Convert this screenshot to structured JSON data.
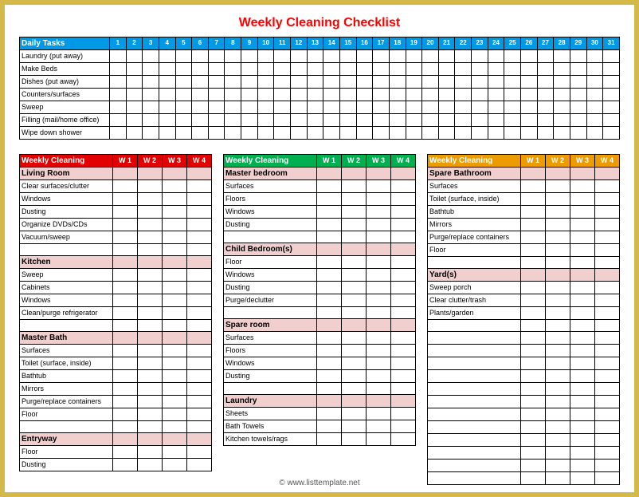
{
  "title": "Weekly Cleaning Checklist",
  "daily_header": "Daily Tasks",
  "daily_days": [
    "1",
    "2",
    "3",
    "4",
    "5",
    "6",
    "7",
    "8",
    "9",
    "10",
    "11",
    "12",
    "13",
    "14",
    "15",
    "16",
    "17",
    "18",
    "19",
    "20",
    "21",
    "22",
    "23",
    "24",
    "25",
    "26",
    "27",
    "28",
    "29",
    "30",
    "31"
  ],
  "daily_tasks": [
    "Laundry (put away)",
    "Make Beds",
    "Dishes (put away)",
    "Counters/surfaces",
    "Sweep",
    "Filling (mail/home office)",
    "Wipe down shower"
  ],
  "weekly_header": "Weekly Cleaning",
  "weeks": [
    "W 1",
    "W 2",
    "W 3",
    "W 4"
  ],
  "col1_sections": [
    {
      "room": "Living Room",
      "tasks": [
        "Clear surfaces/clutter",
        "Windows",
        "Dusting",
        "Organize DVDs/CDs",
        "Vacuum/sweep"
      ]
    },
    {
      "room": "Kitchen",
      "tasks": [
        "Sweep",
        "Cabinets",
        "Windows",
        "Clean/purge refrigerator"
      ]
    },
    {
      "room": "Master Bath",
      "tasks": [
        "Surfaces",
        "Toilet (surface, inside)",
        "Bathtub",
        "Mirrors",
        "Purge/replace containers",
        "Floor"
      ]
    },
    {
      "room": "Entryway",
      "tasks": [
        "Floor",
        "Dusting"
      ]
    }
  ],
  "col2_sections": [
    {
      "room": "Master bedroom",
      "tasks": [
        "Surfaces",
        "Floors",
        "Windows",
        "Dusting"
      ]
    },
    {
      "room": "Child Bedroom(s)",
      "tasks": [
        "Floor",
        "Windows",
        "Dusting",
        "Purge/declutter"
      ]
    },
    {
      "room": "Spare room",
      "tasks": [
        "Surfaces",
        "Floors",
        "Windows",
        "Dusting"
      ]
    },
    {
      "room": "Laundry",
      "tasks": [
        "Sheets",
        "Bath Towels",
        "Kitchen towels/rags"
      ]
    }
  ],
  "col3_sections": [
    {
      "room": "Spare Bathroom",
      "tasks": [
        "Surfaces",
        "Toilet (surface, inside)",
        "Bathtub",
        "Mirrors",
        "Purge/replace containers",
        "Floor"
      ]
    },
    {
      "room": "Yard(s)",
      "tasks": [
        "Sweep porch",
        "Clear clutter/trash",
        "Plants/garden"
      ]
    }
  ],
  "col3_blank_rows": 12,
  "footer": "© www.listtemplate.net"
}
